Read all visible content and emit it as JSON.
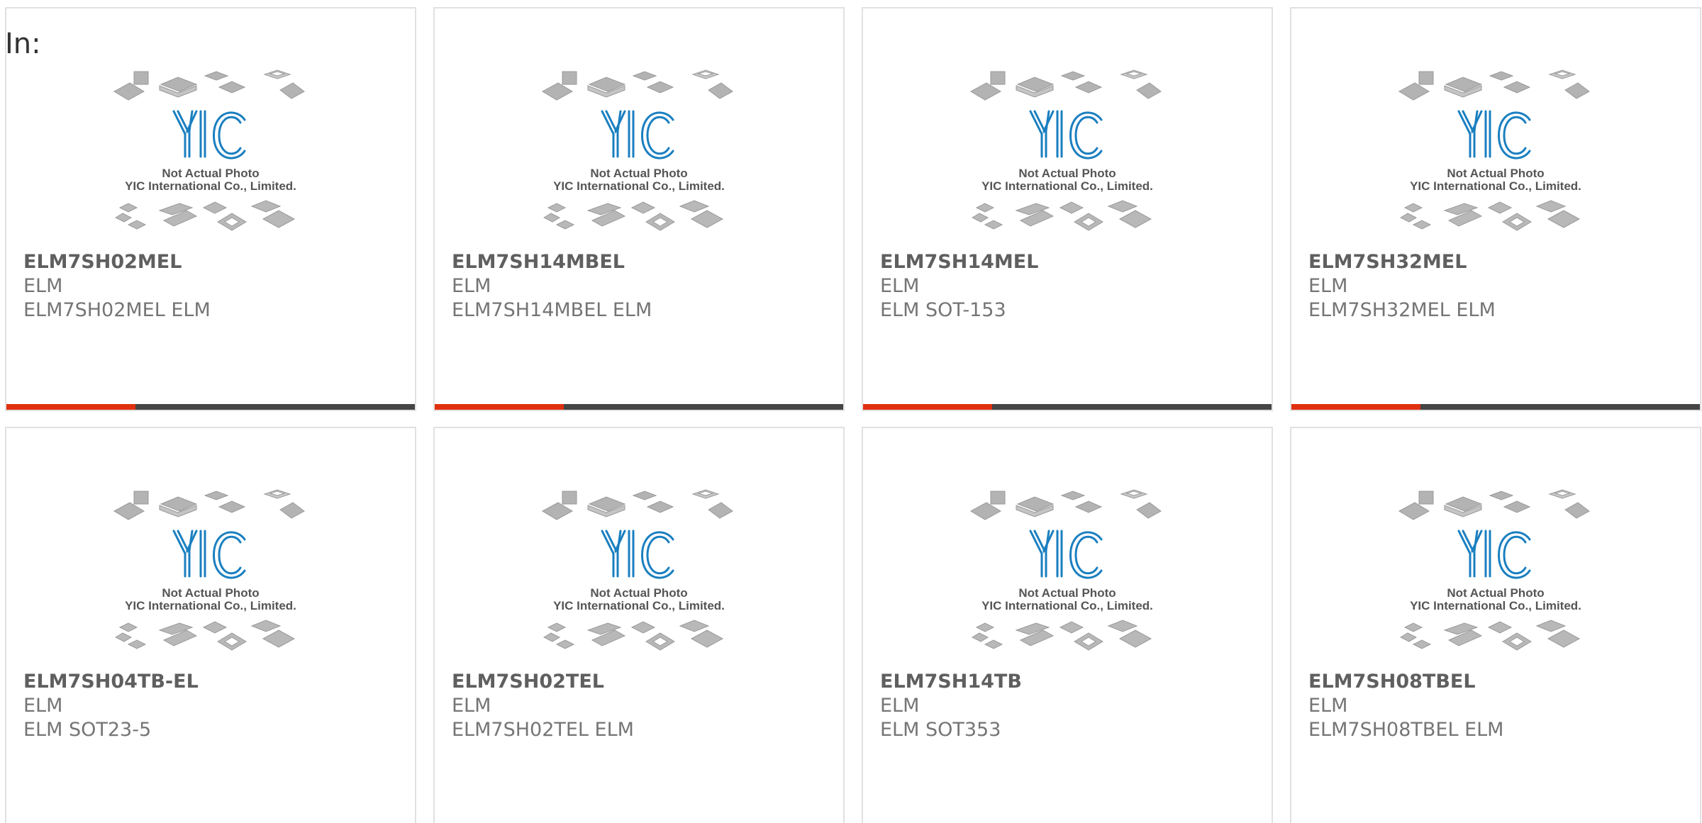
{
  "header": {
    "label": "In:"
  },
  "theme": {
    "accent": "#e03010",
    "bar": "#454545",
    "logo": "#1a7fc0"
  },
  "placeholder": {
    "note_line1": "Not Actual Photo",
    "note_line2": "YIC International Co., Limited.",
    "icon": "chip-packages-placeholder-icon",
    "logo_text": "YIC"
  },
  "products": [
    {
      "part": "ELM7SH02MEL",
      "brand": "ELM",
      "desc": "ELM7SH02MEL ELM"
    },
    {
      "part": "ELM7SH14MBEL",
      "brand": "ELM",
      "desc": "ELM7SH14MBEL ELM"
    },
    {
      "part": "ELM7SH14MEL",
      "brand": "ELM",
      "desc": "ELM SOT-153"
    },
    {
      "part": "ELM7SH32MEL",
      "brand": "ELM",
      "desc": "ELM7SH32MEL ELM"
    },
    {
      "part": "ELM7SH04TB-EL",
      "brand": "ELM",
      "desc": "ELM SOT23-5"
    },
    {
      "part": "ELM7SH02TEL",
      "brand": "ELM",
      "desc": "ELM7SH02TEL ELM"
    },
    {
      "part": "ELM7SH14TB",
      "brand": "ELM",
      "desc": "ELM SOT353"
    },
    {
      "part": "ELM7SH08TBEL",
      "brand": "ELM",
      "desc": "ELM7SH08TBEL ELM"
    }
  ]
}
